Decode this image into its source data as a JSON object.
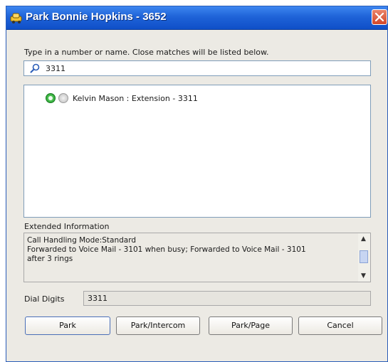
{
  "window": {
    "title": "Park  Bonnie Hopkins - 3652"
  },
  "search": {
    "instruction": "Type in a number or name.  Close matches will be listed below.",
    "value": "3311"
  },
  "results": [
    {
      "label": "Kelvin Mason : Extension - 3311"
    }
  ],
  "extended": {
    "heading": "Extended Information",
    "lines": [
      "Call Handling Mode:Standard",
      "Forwarded to Voice Mail - 3101 when busy; Forwarded to Voice Mail - 3101",
      "after 3 rings"
    ]
  },
  "dial": {
    "label": "Dial Digits",
    "value": "3311"
  },
  "buttons": {
    "park": "Park",
    "park_intercom": "Park/Intercom",
    "park_page": "Park/Page",
    "cancel": "Cancel"
  },
  "colors": {
    "titlebar": "#1f63d8",
    "close": "#d3482a",
    "status_online": "#1f9a2a"
  }
}
